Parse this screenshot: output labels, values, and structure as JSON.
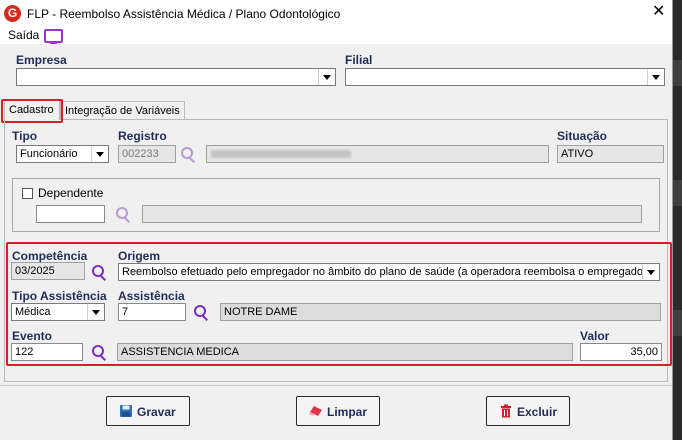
{
  "window": {
    "title": "FLP - Reembolso Assistência Médica / Plano Odontológico",
    "close": "✕",
    "app_logo": "G"
  },
  "menu": {
    "saida": "Saída",
    "monitor_icon": "monitor-icon"
  },
  "empresa": {
    "label": "Empresa",
    "value": ""
  },
  "filial": {
    "label": "Filial",
    "value": ""
  },
  "tabs": [
    {
      "label": "Cadastro",
      "active": true
    },
    {
      "label": "Integração de Variáveis",
      "active": false
    }
  ],
  "tipo": {
    "label": "Tipo",
    "value": "Funcionário"
  },
  "registro": {
    "label": "Registro",
    "value": "002233",
    "name": ""
  },
  "situacao": {
    "label": "Situação",
    "value": "ATIVO"
  },
  "dependente": {
    "label": "Dependente",
    "checked": false,
    "code": "",
    "name": ""
  },
  "competencia": {
    "label": "Competência",
    "value": "03/2025"
  },
  "origem": {
    "label": "Origem",
    "value": "Reembolso efetuado pelo empregador no âmbito do plano de saúde (a operadora reembolsa o empregador)"
  },
  "tipo_assistencia": {
    "label": "Tipo Assistência",
    "value": "Médica"
  },
  "assistencia": {
    "label": "Assistência",
    "code": "7",
    "name": "NOTRE DAME"
  },
  "evento": {
    "label": "Evento",
    "code": "122",
    "name": "ASSISTENCIA MEDICA"
  },
  "valor": {
    "label": "Valor",
    "value": "35,00"
  },
  "buttons": {
    "gravar": "Gravar",
    "limpar": "Limpar",
    "excluir": "Excluir"
  },
  "colors": {
    "highlight": "#d6202a",
    "label": "#1f2e58",
    "search_icon": "#7a2fbf"
  }
}
